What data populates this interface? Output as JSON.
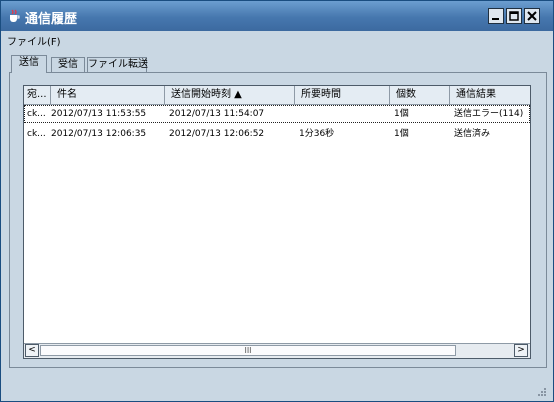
{
  "window": {
    "title": "通信履歴"
  },
  "menu": {
    "file": "ファイル(F)"
  },
  "tabs": [
    {
      "label": "送信"
    },
    {
      "label": "受信"
    },
    {
      "label": "ファイル転送"
    }
  ],
  "table": {
    "columns": [
      {
        "label": "宛..."
      },
      {
        "label": "件名"
      },
      {
        "label": "送信開始時刻 ▲"
      },
      {
        "label": "所要時間"
      },
      {
        "label": "個数"
      },
      {
        "label": "通信結果"
      }
    ],
    "rows": [
      {
        "c1": "ck...",
        "c2": "2012/07/13 11:53:55",
        "c3": "2012/07/13 11:54:07",
        "c4": "",
        "c5": "1個",
        "c6": "送信エラー(114)"
      },
      {
        "c1": "ck...",
        "c2": "2012/07/13 12:06:35",
        "c3": "2012/07/13 12:06:52",
        "c4": "1分36秒",
        "c5": "1個",
        "c6": "送信済み"
      }
    ]
  },
  "scrollbar": {
    "left": "<",
    "right": ">",
    "grip": "III"
  }
}
